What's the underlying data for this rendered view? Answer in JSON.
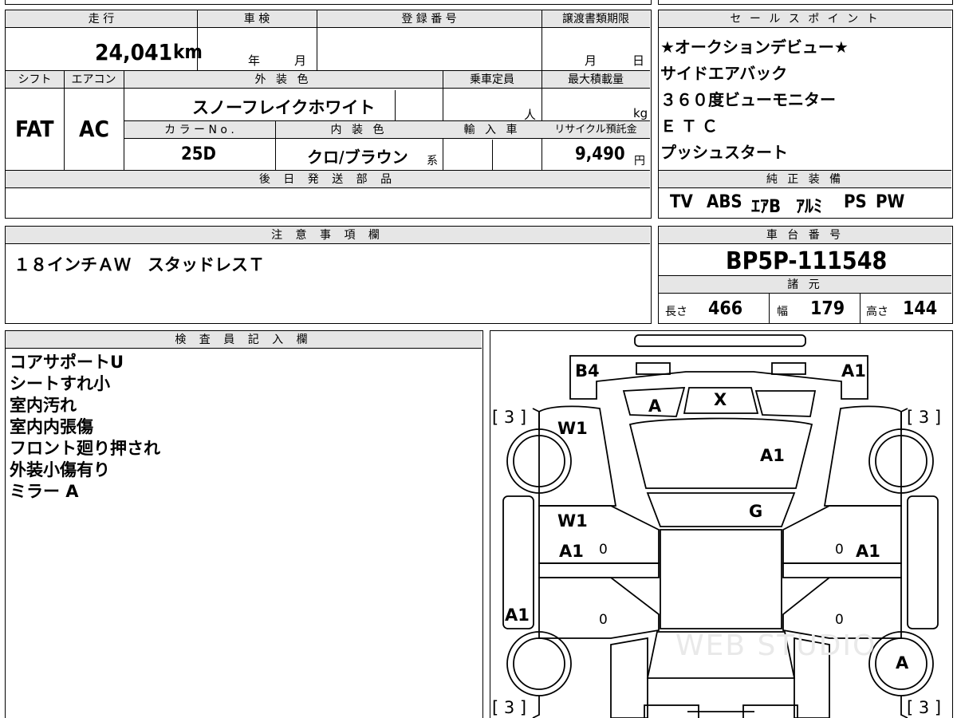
{
  "main": {
    "headers": {
      "mileage": "走 行",
      "shaken": "車 検",
      "registration": "登 録 番 号",
      "transfer_deadline": "譲渡書類期限",
      "shift": "シフト",
      "aircon": "エアコン",
      "exterior_color": "外 装 色",
      "capacity": "乗車定員",
      "max_load": "最大積載量",
      "color_no": "カ ラ ー N o .",
      "interior_color": "内 装 色",
      "import": "輸 入 車",
      "recycle": "リサイクル預託金",
      "later_parts": "後 日 発 送 部 品"
    },
    "mileage_value": "24,041",
    "mileage_unit": "km",
    "shaken_year": "年",
    "shaken_month": "月",
    "transfer_month": "月",
    "transfer_day": "日",
    "shift_value": "FAT",
    "aircon_value": "AC",
    "exterior_color_value": "スノーフレイクホワイト",
    "capacity_unit": "人",
    "max_load_unit": "kg",
    "color_no_value": "25D",
    "interior_color_value": "クロ/ブラウン",
    "interior_suffix": "系",
    "recycle_value": "9,490",
    "recycle_unit": "円"
  },
  "sales": {
    "header": "セ ー ル ス ポ イ ン ト",
    "lines": [
      "★オークションデビュー★",
      "サイドエアバック",
      "３６０度ビューモニター",
      "ＥＴＣ",
      "プッシュスタート"
    ]
  },
  "equipment": {
    "header": "純 正 装 備",
    "items": [
      "TV",
      "ABS",
      "ｴｱB",
      "ｱﾙﾐ",
      "PS",
      "PW"
    ]
  },
  "notes": {
    "header": "注 意 事 項 欄",
    "text": "１８インチＡＷ　スタッドレスＴ"
  },
  "chassis": {
    "header": "車 台 番 号",
    "number": "BP5P-111548",
    "specs_header": "諸 元",
    "length_label": "長さ",
    "length_value": "466",
    "width_label": "幅",
    "width_value": "179",
    "height_label": "高さ",
    "height_value": "144"
  },
  "inspector": {
    "header": "検 査 員 記 入 欄",
    "lines": [
      "コアサポートU",
      "シートすれ小",
      "室内汚れ",
      "室内内張傷",
      "フロント廻り押され",
      "外装小傷有り",
      "ミラー A"
    ]
  },
  "diagram": {
    "tire_tl": "[ 3 ]",
    "tire_tr": "[ 3 ]",
    "tire_bl": "[ 3 ]",
    "tire_br": "[ 3 ]",
    "marks": {
      "b4": "B4",
      "a1_front_right": "A1",
      "a_front": "A",
      "x_front": "X",
      "w1_fender": "W1",
      "a1_hood": "A1",
      "g_windshield": "G",
      "w1_door": "W1",
      "a1_door_left": "A1",
      "a1_door_right": "A1",
      "a1_rear_left": "A1",
      "a_rear_tire": "A",
      "zero_1": "0",
      "zero_2": "0",
      "zero_3": "0",
      "zero_4": "0"
    },
    "watermark": "WEB STUDIO"
  }
}
